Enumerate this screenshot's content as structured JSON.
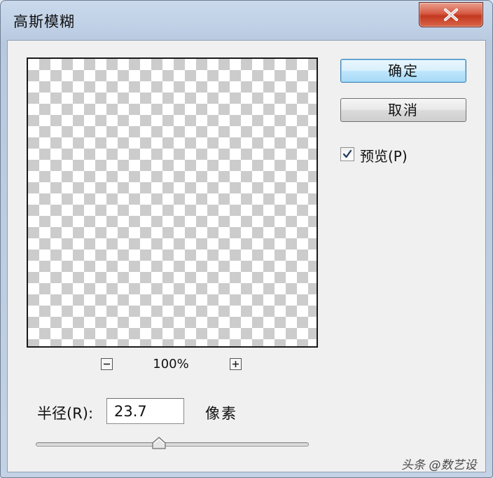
{
  "window": {
    "title": "高斯模糊",
    "close_icon": "close-x-icon"
  },
  "buttons": {
    "ok_label": "确定",
    "cancel_label": "取消"
  },
  "preview_checkbox": {
    "label": "预览(P)",
    "checked": true
  },
  "zoom": {
    "value": "100%",
    "minus_icon": "minus-icon",
    "plus_icon": "plus-icon"
  },
  "radius": {
    "label": "半径(R):",
    "value": "23.7",
    "unit": "像素"
  },
  "slider": {
    "thumb_icon": "slider-thumb-icon"
  },
  "watermark": {
    "text": "头条 @数艺设"
  },
  "colors": {
    "ok_button_border": "#3c7fb1",
    "close_button": "#c2381f",
    "checker_gray": "#cccccc"
  }
}
